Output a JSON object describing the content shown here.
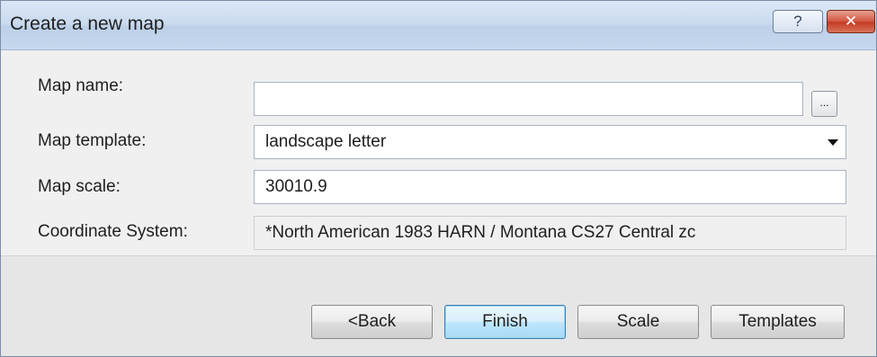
{
  "window": {
    "title": "Create a new map",
    "help_label": "?",
    "close_label": "✕"
  },
  "form": {
    "map_name": {
      "label": "Map name:",
      "value": "",
      "browse_label": "..."
    },
    "map_template": {
      "label": "Map template:",
      "value": "landscape letter"
    },
    "map_scale": {
      "label": "Map scale:",
      "value": "30010.9"
    },
    "coordinate_system": {
      "label": "Coordinate System:",
      "value": "*North American 1983 HARN / Montana CS27 Central zc"
    }
  },
  "buttons": {
    "back": "<Back",
    "finish": "Finish",
    "scale": "Scale",
    "templates": "Templates"
  }
}
